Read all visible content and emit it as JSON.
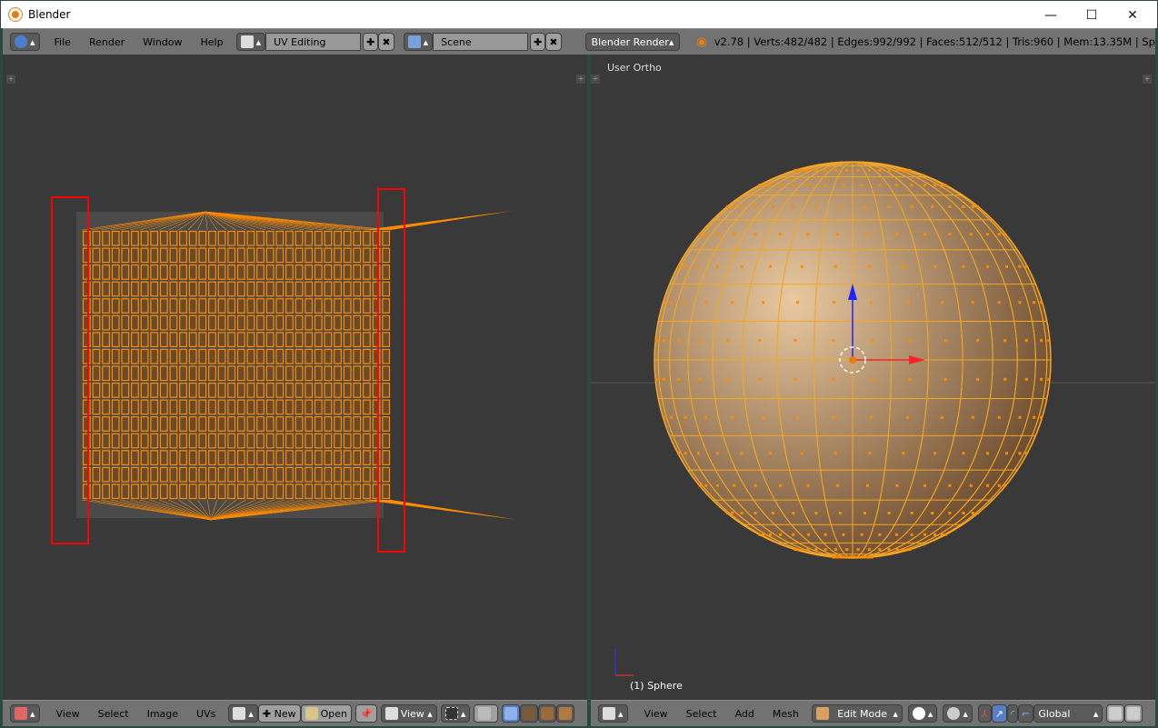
{
  "window": {
    "title": "Blender",
    "minimize": "—",
    "maximize": "☐",
    "close": "✕"
  },
  "top_header": {
    "menus": [
      "File",
      "Render",
      "Window",
      "Help"
    ],
    "screen_layout": "UV Editing",
    "scene": "Scene",
    "render_engine": "Blender Render",
    "stats": "v2.78 | Verts:482/482 | Edges:992/992 | Faces:512/512 | Tris:960 | Mem:13.35M | Sp"
  },
  "viewport": {
    "label": "User Ortho",
    "object": "(1) Sphere"
  },
  "uv_header": {
    "menus": [
      "View",
      "Select",
      "Image",
      "UVs"
    ],
    "new_label": "New",
    "open_label": "Open",
    "view_label": "View"
  },
  "view3d_header": {
    "menus": [
      "View",
      "Select",
      "Add",
      "Mesh"
    ],
    "mode": "Edit Mode",
    "orientation": "Global"
  },
  "colors": {
    "accent": "#f5a623",
    "uv_edge": "#ff8c00",
    "highlight": "#ff0000",
    "select": "#5680c2"
  }
}
